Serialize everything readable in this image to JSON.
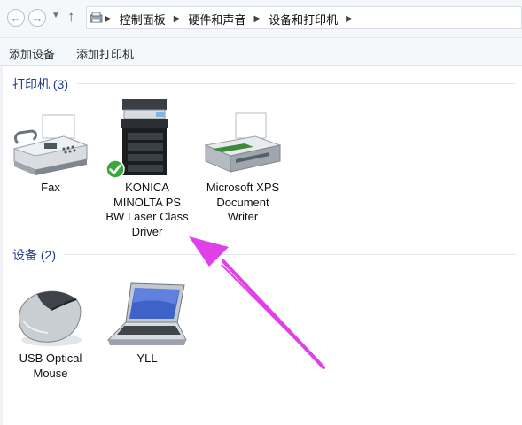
{
  "address": {
    "crumbs": [
      "控制面板",
      "硬件和声音",
      "设备和打印机"
    ]
  },
  "toolbar": {
    "add_device": "添加设备",
    "add_printer": "添加打印机"
  },
  "groups": {
    "printers": "打印机 (3)",
    "devices": "设备 (2)"
  },
  "printers": [
    {
      "lines": [
        "Fax"
      ],
      "icon": "fax-icon"
    },
    {
      "lines": [
        "KONICA",
        "MINOLTA PS",
        "BW Laser Class",
        "Driver"
      ],
      "icon": "printer-konica-icon",
      "default": true
    },
    {
      "lines": [
        "Microsoft XPS",
        "Document",
        "Writer"
      ],
      "icon": "printer-xps-icon"
    }
  ],
  "devices": [
    {
      "lines": [
        "USB Optical",
        "Mouse"
      ],
      "icon": "mouse-icon"
    },
    {
      "lines": [
        "YLL"
      ],
      "icon": "laptop-icon"
    }
  ],
  "colors": {
    "group_header": "#1e3a8a",
    "annotation_arrow": "#e040e8",
    "default_check": "#3aa83a"
  }
}
